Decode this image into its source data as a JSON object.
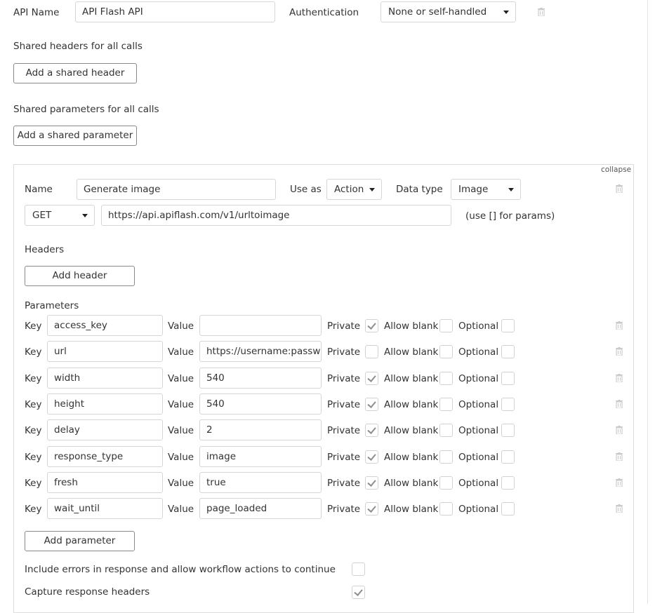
{
  "api": {
    "name_label": "API Name",
    "name_value": "API Flash API",
    "auth_label": "Authentication",
    "auth_value": "None or self-handled",
    "shared_headers_label": "Shared headers for all calls",
    "add_shared_header": "Add a shared header",
    "shared_params_label": "Shared parameters for all calls",
    "add_shared_param": "Add a shared parameter"
  },
  "call": {
    "collapse": "collapse",
    "name_label": "Name",
    "name_value": "Generate image",
    "use_as_label": "Use as",
    "use_as_value": "Action",
    "data_type_label": "Data type",
    "data_type_value": "Image",
    "method": "GET",
    "url": "https://api.apiflash.com/v1/urltoimage",
    "url_hint": "(use [] for params)",
    "headers_label": "Headers",
    "add_header": "Add header",
    "params_label": "Parameters",
    "key_label": "Key",
    "value_label": "Value",
    "private_label": "Private",
    "allow_blank_label": "Allow blank",
    "optional_label": "Optional",
    "params": [
      {
        "key": "access_key",
        "value": "",
        "private": true
      },
      {
        "key": "url",
        "value": "https://username:password",
        "private": false
      },
      {
        "key": "width",
        "value": "540",
        "private": true
      },
      {
        "key": "height",
        "value": "540",
        "private": true
      },
      {
        "key": "delay",
        "value": "2",
        "private": true
      },
      {
        "key": "response_type",
        "value": "image",
        "private": true
      },
      {
        "key": "fresh",
        "value": "true",
        "private": true
      },
      {
        "key": "wait_until",
        "value": "page_loaded",
        "private": true
      }
    ],
    "add_parameter": "Add parameter",
    "include_errors_label": "Include errors in response and allow workflow actions to continue",
    "include_errors_checked": false,
    "capture_headers_label": "Capture response headers",
    "capture_headers_checked": true
  },
  "icons": {
    "trash": "trash-icon",
    "caret": "chevron-down-icon",
    "check": "check-icon"
  },
  "colors": {
    "border": "#d6d6d6",
    "button_border": "#8a8a8a",
    "text": "#333333",
    "trash": "#c8c8c8"
  }
}
